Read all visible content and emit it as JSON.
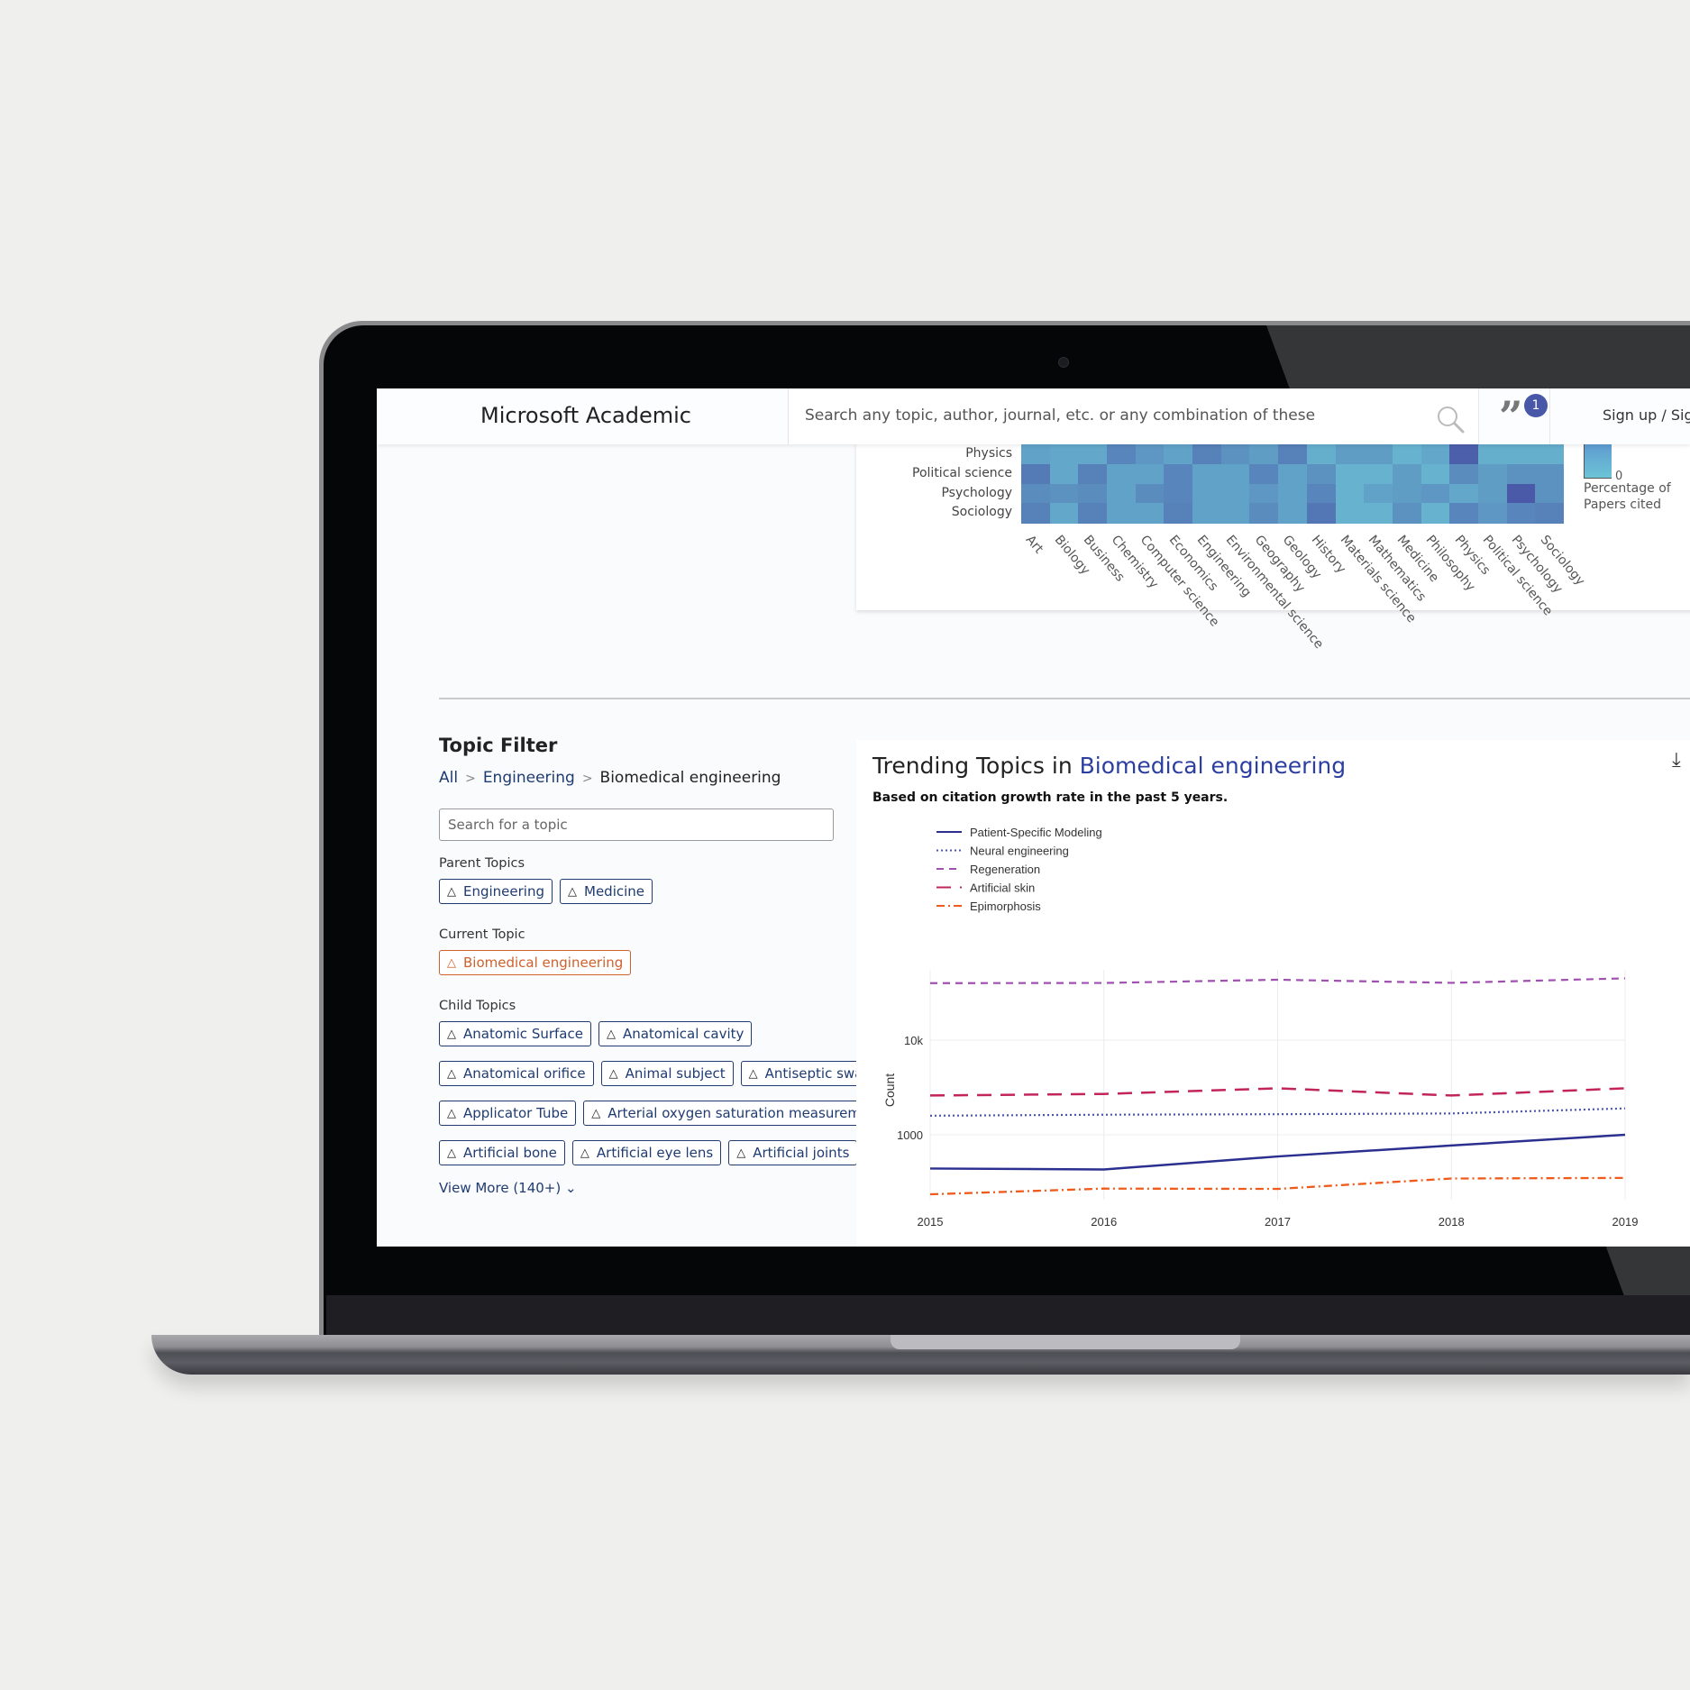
{
  "header": {
    "brand": "Microsoft Academic",
    "search_placeholder": "Search any topic, author, journal, etc. or any combination of these",
    "notification_count": "1",
    "signup_label": "Sign up / Sign"
  },
  "heatmap": {
    "row_labels": [
      "Physics",
      "Political science",
      "Psychology",
      "Sociology"
    ],
    "col_labels": [
      "Art",
      "Biology",
      "Business",
      "Chemistry",
      "Computer science",
      "Economics",
      "Engineering",
      "Environmental science",
      "Geography",
      "Geology",
      "History",
      "Materials science",
      "Mathematics",
      "Medicine",
      "Philosophy",
      "Physics",
      "Political science",
      "Psychology",
      "Sociology"
    ],
    "intensity": [
      [
        0.3,
        0.25,
        0.25,
        0.55,
        0.4,
        0.3,
        0.6,
        0.45,
        0.35,
        0.6,
        0.2,
        0.35,
        0.35,
        0.15,
        0.25,
        0.9,
        0.2,
        0.2,
        0.2
      ],
      [
        0.65,
        0.25,
        0.6,
        0.3,
        0.3,
        0.55,
        0.3,
        0.3,
        0.55,
        0.3,
        0.45,
        0.15,
        0.15,
        0.35,
        0.15,
        0.5,
        0.35,
        0.45,
        0.45
      ],
      [
        0.5,
        0.45,
        0.5,
        0.3,
        0.5,
        0.55,
        0.3,
        0.3,
        0.4,
        0.3,
        0.55,
        0.15,
        0.3,
        0.35,
        0.4,
        0.25,
        0.35,
        0.95,
        0.45
      ],
      [
        0.6,
        0.25,
        0.6,
        0.3,
        0.3,
        0.6,
        0.3,
        0.3,
        0.5,
        0.3,
        0.7,
        0.15,
        0.15,
        0.45,
        0.15,
        0.55,
        0.4,
        0.55,
        0.6
      ]
    ],
    "legend_zero": "0",
    "legend_title": "Percentage of Papers cited"
  },
  "topic_filter": {
    "title": "Topic Filter",
    "breadcrumb": [
      "All",
      "Engineering",
      "Biomedical engineering"
    ],
    "search_placeholder": "Search for a topic",
    "parent_label": "Parent Topics",
    "parent_topics": [
      "Engineering",
      "Medicine"
    ],
    "current_label": "Current Topic",
    "current_topic": "Biomedical engineering",
    "child_label": "Child Topics",
    "child_topics": [
      [
        "Anatomic Surface",
        "Anatomical cavity"
      ],
      [
        "Anatomical orifice",
        "Animal subject",
        "Antiseptic swab"
      ],
      [
        "Applicator Tube",
        "Arterial oxygen saturation measurement"
      ],
      [
        "Artificial bone",
        "Artificial eye lens",
        "Artificial joints"
      ]
    ],
    "view_more": "View More (140+)"
  },
  "trending": {
    "title_prefix": "Trending Topics in",
    "title_topic": "Biomedical engineering",
    "subtitle": "Based on citation growth rate in the past 5 years."
  },
  "chart_data": {
    "type": "line",
    "title": "Trending Topics in Biomedical engineering",
    "subtitle": "Based on citation growth rate in the past 5 years.",
    "xlabel": "",
    "ylabel": "Count",
    "y_scale": "log",
    "x": [
      2015,
      2016,
      2017,
      2018,
      2019
    ],
    "x_tick_labels": [
      "2015",
      "2016",
      "2017",
      "2018",
      "2019"
    ],
    "y_ticks": [
      1000,
      10000
    ],
    "y_tick_labels": [
      "1000",
      "10k"
    ],
    "grid": true,
    "legend_position": "top-left",
    "series": [
      {
        "name": "Patient-Specific Modeling",
        "color": "#2b2f8f",
        "dash": "solid",
        "values": [
          440,
          430,
          590,
          770,
          1000
        ]
      },
      {
        "name": "Neural engineering",
        "color": "#4a55b5",
        "dash": "dot",
        "values": [
          1590,
          1630,
          1650,
          1680,
          1900
        ]
      },
      {
        "name": "Regeneration",
        "color": "#a050b0",
        "dash": "dash",
        "values": [
          40000,
          40200,
          43500,
          40300,
          45000
        ]
      },
      {
        "name": "Artificial skin",
        "color": "#c2255c",
        "dash": "longdash",
        "values": [
          2600,
          2700,
          3100,
          2600,
          3100
        ]
      },
      {
        "name": "Epimorphosis",
        "color": "#f05a1a",
        "dash": "dashdot",
        "values": [
          235,
          270,
          268,
          345,
          350
        ]
      }
    ]
  }
}
